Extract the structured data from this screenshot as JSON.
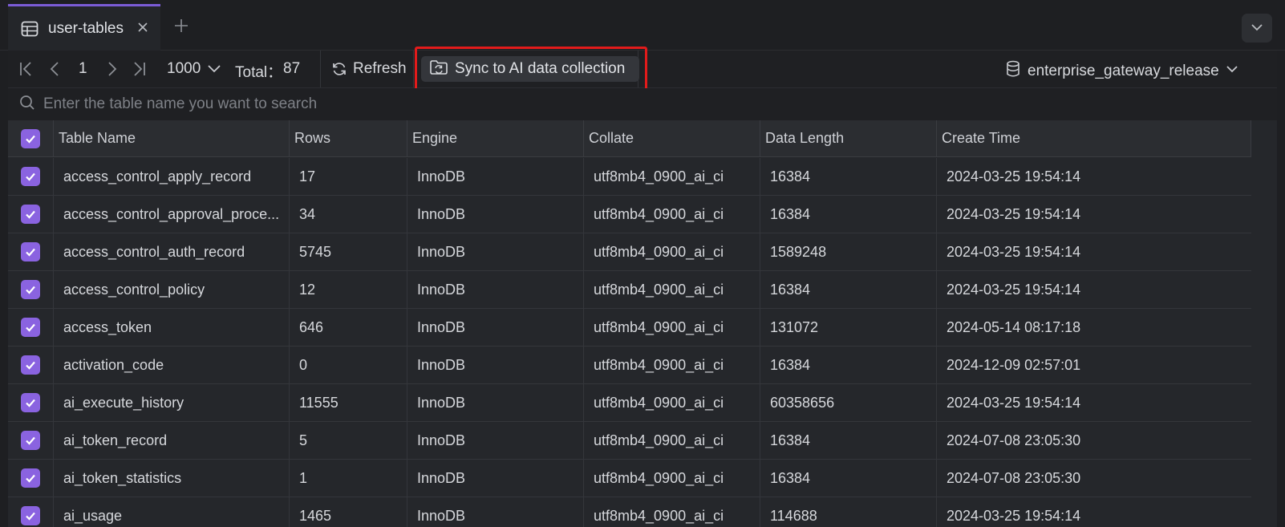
{
  "tab": {
    "label": "user-tables",
    "icon": "table-icon",
    "accent": "#7b5cd6"
  },
  "toolbar": {
    "page": "1",
    "page_size": "1000",
    "total_label": "Total：",
    "total_value": "87",
    "refresh_label": "Refresh",
    "sync_label": "Sync to AI data collection",
    "database": "enterprise_gateway_release",
    "highlight_color": "#e21b1b"
  },
  "search": {
    "placeholder": "Enter the table name you want to search"
  },
  "table": {
    "headers": [
      "Table Name",
      "Rows",
      "Engine",
      "Collate",
      "Data Length",
      "Create Time"
    ],
    "rows": [
      {
        "name": "access_control_apply_record",
        "rows": "17",
        "engine": "InnoDB",
        "collate": "utf8mb4_0900_ai_ci",
        "length": "16384",
        "time": "2024-03-25 19:54:14"
      },
      {
        "name": "access_control_approval_proce...",
        "rows": "34",
        "engine": "InnoDB",
        "collate": "utf8mb4_0900_ai_ci",
        "length": "16384",
        "time": "2024-03-25 19:54:14"
      },
      {
        "name": "access_control_auth_record",
        "rows": "5745",
        "engine": "InnoDB",
        "collate": "utf8mb4_0900_ai_ci",
        "length": "1589248",
        "time": "2024-03-25 19:54:14"
      },
      {
        "name": "access_control_policy",
        "rows": "12",
        "engine": "InnoDB",
        "collate": "utf8mb4_0900_ai_ci",
        "length": "16384",
        "time": "2024-03-25 19:54:14"
      },
      {
        "name": "access_token",
        "rows": "646",
        "engine": "InnoDB",
        "collate": "utf8mb4_0900_ai_ci",
        "length": "131072",
        "time": "2024-05-14 08:17:18"
      },
      {
        "name": "activation_code",
        "rows": "0",
        "engine": "InnoDB",
        "collate": "utf8mb4_0900_ai_ci",
        "length": "16384",
        "time": "2024-12-09 02:57:01"
      },
      {
        "name": "ai_execute_history",
        "rows": "11555",
        "engine": "InnoDB",
        "collate": "utf8mb4_0900_ai_ci",
        "length": "60358656",
        "time": "2024-03-25 19:54:14"
      },
      {
        "name": "ai_token_record",
        "rows": "5",
        "engine": "InnoDB",
        "collate": "utf8mb4_0900_ai_ci",
        "length": "16384",
        "time": "2024-07-08 23:05:30"
      },
      {
        "name": "ai_token_statistics",
        "rows": "1",
        "engine": "InnoDB",
        "collate": "utf8mb4_0900_ai_ci",
        "length": "16384",
        "time": "2024-07-08 23:05:30"
      },
      {
        "name": "ai_usage",
        "rows": "1465",
        "engine": "InnoDB",
        "collate": "utf8mb4_0900_ai_ci",
        "length": "114688",
        "time": "2024-03-25 19:54:14"
      }
    ]
  },
  "colors": {
    "checkbox": "#8a63e0",
    "background": "#1e1f22"
  }
}
